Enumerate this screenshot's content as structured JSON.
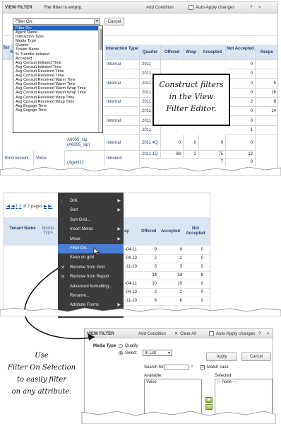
{
  "top": {
    "view_filter_title": "VIEW FILTER",
    "empty_message": "The filter is empty.",
    "add_condition": "Add Condition",
    "auto_apply": "Auto-Apply changes",
    "help": "?",
    "close": "×",
    "filter_select_value": "Filter On:",
    "cancel_label": "Cancel",
    "dropdown_items": [
      "Filter On:",
      "Agent Name",
      "Interaction Type",
      "Media Type",
      "Quarter",
      "Tenant Name",
      "% Transfer Initiated",
      "Accepted",
      "Avg Consult Initiated Time",
      "Avg Consult Initiated Time",
      "Avg Consult Received Time",
      "Avg Consult Received Time",
      "Avg Consult Received Warm Time",
      "Avg Consult Received Warm Time",
      "Avg Consult Received Warm Wrap Time",
      "Avg Consult Received Warm Wrap Time",
      "Avg Consult Received Wrap Time",
      "Avg Consult Received Wrap Time",
      "Avg Engage Time",
      "Avg Engage Time"
    ],
    "grid_headers": {
      "tenant": "Ten",
      "name": "Na",
      "interaction_type": "Interaction Type",
      "quarter": "Quarter",
      "offered": "Offered",
      "wrap": "Wrap",
      "accepted": "Accepted",
      "not_accepted": "Not Accepted",
      "respo": "Respo"
    },
    "grid_rows": [
      {
        "type": "Internal",
        "quarter": "2011",
        "not_accepted": "0",
        "extra": ""
      },
      {
        "type": "",
        "quarter": "2011",
        "not_accepted": "0",
        "extra": ""
      },
      {
        "type": "Internal",
        "quarter": "2011",
        "not_accepted": "0",
        "extra": "5"
      },
      {
        "type": "",
        "quarter": "2011",
        "not_accepted": "0",
        "extra": "16"
      },
      {
        "type": "Internal",
        "quarter": "2011",
        "not_accepted": "2",
        "extra": "8"
      },
      {
        "type": "",
        "quarter": "2011",
        "not_accepted": "0",
        "extra": "14"
      },
      {
        "type": "Internal",
        "quarter": "2011",
        "not_accepted": "0",
        "extra": ""
      },
      {
        "type": "",
        "quarter": "2011",
        "not_accepted": "1",
        "extra": ""
      }
    ],
    "agent_row": {
      "agent": "A6005_sip (A6005_sip)",
      "type": "Internal",
      "quarter": "2011 4Q",
      "offered": "0",
      "wrap": "0",
      "accepted": "0",
      "not_accepted": "0"
    },
    "last_row": {
      "tenant": "Environment",
      "media": "Voice",
      "agent": "(Agent1)",
      "type": "Inbound",
      "quarter": "2011 1Q",
      "offered": "88",
      "wrap": "2",
      "accepted": "75",
      "not_accepted": "13",
      "partial_accepted": "7",
      "partial_not_accepted": "0"
    },
    "callout": [
      "Construct filters",
      "in the View",
      "Filter Editor."
    ]
  },
  "mid": {
    "pager_first": "|◀",
    "pager_prev": "◀",
    "pager_page1": "1",
    "pager_page2": "2",
    "pager_text": "of 2 pages",
    "pager_next": "▶",
    "pager_last": "▶|",
    "headers": {
      "tenant_name": "Tenant Name",
      "media_type": "Media Type",
      "day": "ay",
      "offered": "Offered",
      "accepted": "Accepted",
      "not_accepted": "Not Accepted"
    },
    "rows": [
      {
        "day": "-04-11",
        "offered": "9",
        "accepted": "9",
        "not_accepted": "0"
      },
      {
        "day": "-04-13",
        "offered": "2",
        "accepted": "2",
        "not_accepted": "0"
      },
      {
        "day": "-11-10",
        "offered": "3",
        "accepted": "3",
        "not_accepted": "0"
      },
      {
        "day": "",
        "offered": "14",
        "accepted": "14",
        "not_accepted": "0"
      },
      {
        "day": "-04-11",
        "offered": "10",
        "accepted": "10",
        "not_accepted": "0"
      },
      {
        "day": "-04-13",
        "offered": "2",
        "accepted": "2",
        "not_accepted": "0"
      },
      {
        "day": "-11-10",
        "offered": "6",
        "accepted": "6",
        "not_accepted": "0"
      }
    ],
    "menu_items": [
      {
        "label": "Drill",
        "arrow": true,
        "x": ""
      },
      {
        "label": "Sort",
        "arrow": true,
        "x": ""
      },
      {
        "label": "Sort Grid...",
        "arrow": false,
        "x": ""
      },
      {
        "label": "Insert Metric",
        "arrow": true,
        "x": ""
      },
      {
        "label": "Move",
        "arrow": true,
        "x": ""
      },
      {
        "label": "Filter On...",
        "arrow": false,
        "x": "",
        "highlight": true
      },
      {
        "label": "Keep on grid",
        "arrow": false,
        "x": ""
      },
      {
        "label": "Remove from Grid",
        "arrow": false,
        "x": "✕"
      },
      {
        "label": "Remove from Report",
        "arrow": false,
        "x": "✕"
      },
      {
        "label": "Advanced formatting...",
        "arrow": false,
        "x": ""
      },
      {
        "label": "Rename...",
        "arrow": false,
        "x": ""
      },
      {
        "label": "Attribute Forms",
        "arrow": true,
        "x": ""
      },
      {
        "label": "Derived Elements",
        "arrow": false,
        "x": ""
      }
    ]
  },
  "bottom": {
    "title": "VIEW FILTER",
    "add_condition": "Add Condition",
    "clear_all": "Clear All",
    "auto_apply": "Auto-Apply changes",
    "help": "?",
    "close": "×",
    "media_type_label": "Media Type",
    "qualify": "Qualify",
    "select": "Select",
    "in_list": "In List",
    "apply": "Apply",
    "cancel": "Cancel",
    "search_for": "Search for:",
    "match_case": "Match case",
    "available": "Available:",
    "selected": "Selected:",
    "available_items": [
      "Voice"
    ],
    "selected_items": [
      "--- none ---"
    ],
    "callout": [
      "Use",
      "Filter On Selection",
      "to easily filter",
      "on any attribute."
    ]
  }
}
